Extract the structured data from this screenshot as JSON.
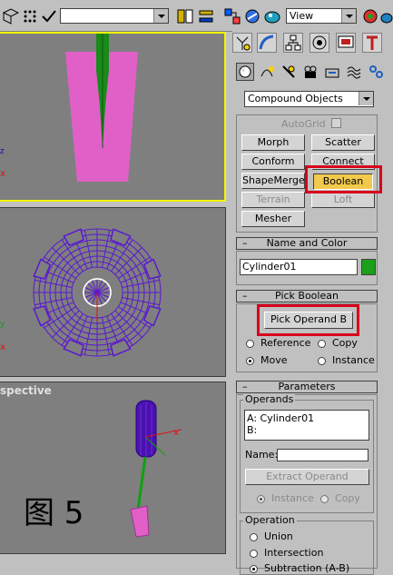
{
  "toolbar": {
    "selection_set_value": "",
    "view_dropdown_value": "View"
  },
  "viewports": {
    "perspective_label": "spective",
    "caption": "图 5"
  },
  "command_panel": {
    "category_dropdown": "Compound Objects",
    "object_type": {
      "autogrid_label": "AutoGrid",
      "buttons": [
        "Morph",
        "Scatter",
        "Conform",
        "Connect",
        "ShapeMerge",
        "Boolean",
        "Terrain",
        "Loft",
        "Mesher"
      ]
    },
    "name_and_color": {
      "title": "Name and Color",
      "name_value": "Cylinder01",
      "color": "#1aa01a"
    },
    "pick_boolean": {
      "title": "Pick Boolean",
      "pick_button": "Pick Operand B",
      "options": [
        "Reference",
        "Copy",
        "Move",
        "Instance"
      ]
    },
    "parameters": {
      "title": "Parameters",
      "operands_label": "Operands",
      "operand_a": "A: Cylinder01",
      "operand_b": "B:",
      "name_label": "Name:",
      "name_value": "",
      "extract_button": "Extract Operand",
      "extract_options": [
        "Instance",
        "Copy"
      ],
      "operation_label": "Operation",
      "operations": [
        "Union",
        "Intersection",
        "Subtraction (A-B)"
      ]
    }
  },
  "colors": {
    "highlight_box": "#d8001b",
    "active_viewport_border": "#f4f400",
    "boolean_active": "#f2c94c"
  }
}
